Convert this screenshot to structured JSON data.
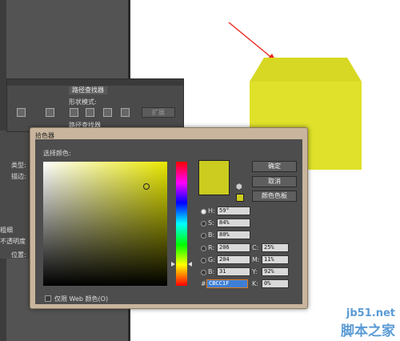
{
  "pathfinder_panel": {
    "tab": "路径查找器",
    "shape_modes_label": "形状模式:",
    "pathfinders_label": "路径查找器",
    "expand_button": "扩展"
  },
  "side_panel": {
    "items": [
      "类型:",
      "描边:",
      "不透明度",
      "位置:",
      "粗细"
    ]
  },
  "color_picker": {
    "title": "拾色器",
    "select_color_label": "选择颜色:",
    "ok_button": "确定",
    "cancel_button": "取消",
    "swatches_button": "颜色色板",
    "H": {
      "label": "H:",
      "value": "59°"
    },
    "S": {
      "label": "S:",
      "value": "84%"
    },
    "B": {
      "label": "B:",
      "value": "80%"
    },
    "R": {
      "label": "R:",
      "value": "206"
    },
    "G": {
      "label": "G:",
      "value": "204"
    },
    "Bv": {
      "label": "B:",
      "value": "31"
    },
    "C": {
      "label": "C:",
      "value": "25%"
    },
    "M": {
      "label": "M:",
      "value": "11%"
    },
    "Y": {
      "label": "Y:",
      "value": "92%"
    },
    "K": {
      "label": "K:",
      "value": "0%"
    },
    "hex_label": "#",
    "hex_value": "CBCC1F",
    "web_only_label": "仅限 Web 颜色(O)"
  },
  "colors": {
    "shape_fill": "#dfe12a",
    "shape_top": "#d6d823",
    "selected_color": "#cbcc1f",
    "arrow": "#e8261c"
  },
  "watermark": {
    "url": "jb51.net",
    "name": "脚本之家"
  }
}
